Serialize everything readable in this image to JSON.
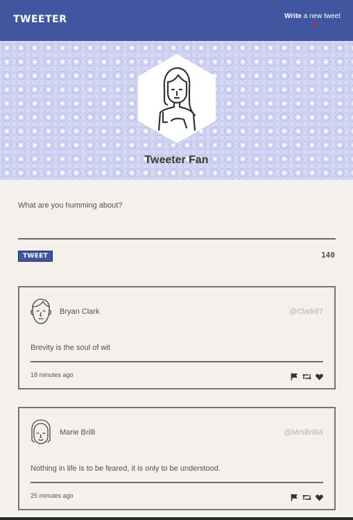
{
  "nav": {
    "logo": "TWEETER",
    "compose_bold": "Write",
    "compose_rest": " a new tweet",
    "compose_icon": "chevron-down-icon"
  },
  "profile": {
    "name": "Tweeter Fan",
    "avatar_icon": "woman-avatar-icon"
  },
  "composer": {
    "placeholder": "What are you humming about?",
    "button_label": "TWEET",
    "counter": "140"
  },
  "tweets": [
    {
      "name": "Bryan Clark",
      "handle": "@Clark67",
      "content": "Brevity is the soul of wit",
      "time": "18 minutes ago",
      "avatar_icon": "man-avatar-icon"
    },
    {
      "name": "Marie Brilli",
      "handle": "@MrsBrilli4",
      "content": "Nothing in life is to be feared, it is only to be understood.",
      "time": "25 minutes ago",
      "avatar_icon": "woman-bangs-avatar-icon"
    }
  ],
  "actions": [
    "flag-icon",
    "retweet-icon",
    "heart-icon"
  ],
  "colors": {
    "nav": "#4056a1",
    "background": "#f4f1ec",
    "accent_red": "#d4291c",
    "text": "#545149"
  }
}
